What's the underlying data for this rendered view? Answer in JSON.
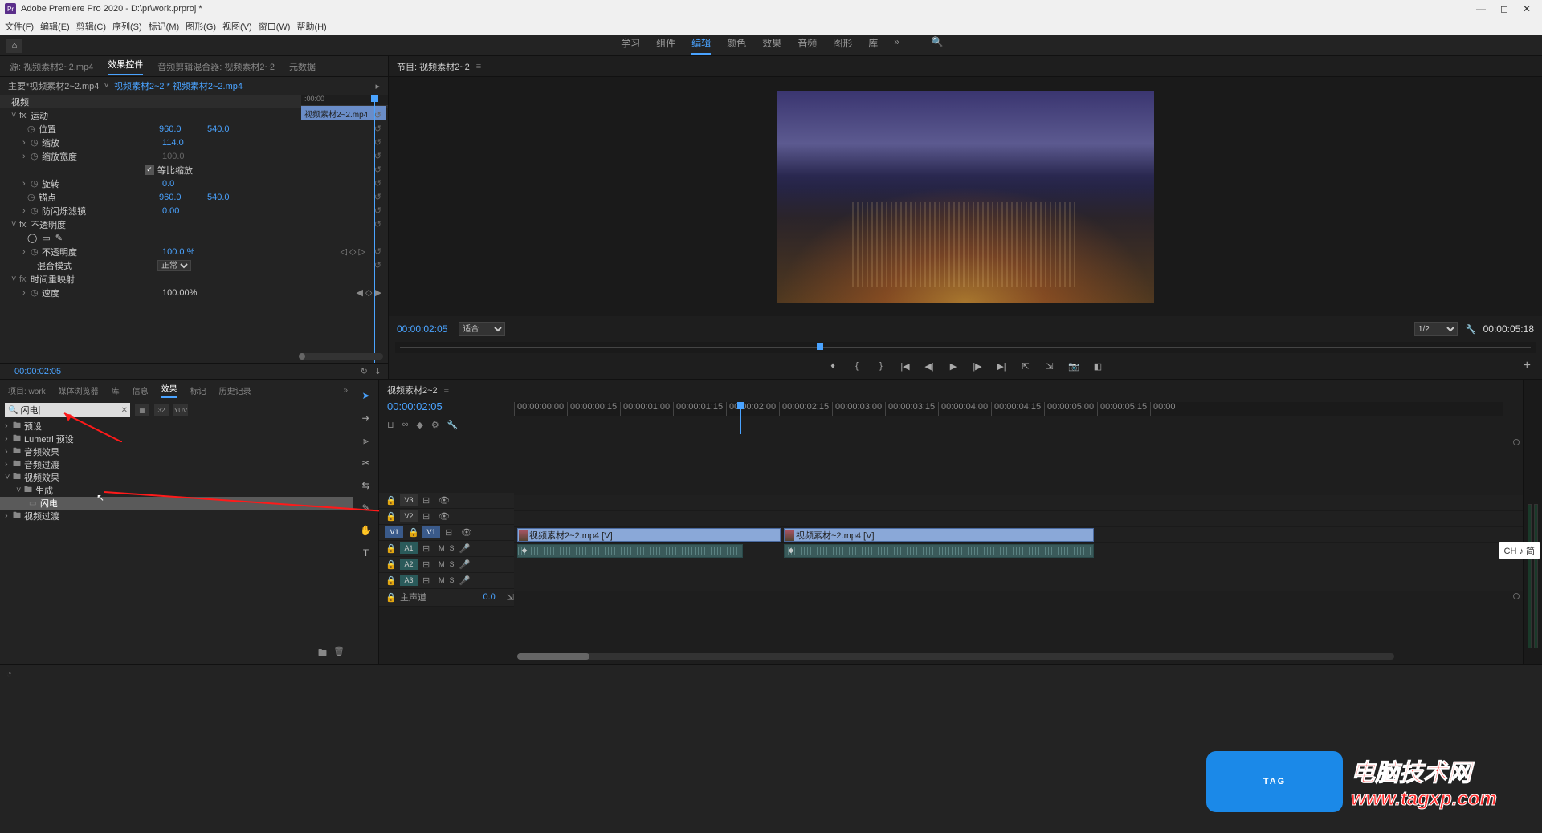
{
  "app": {
    "title": "Adobe Premiere Pro 2020 - D:\\pr\\work.prproj *"
  },
  "menu": {
    "file": "文件(F)",
    "edit": "编辑(E)",
    "clip": "剪辑(C)",
    "seq": "序列(S)",
    "mark": "标记(M)",
    "graph": "图形(G)",
    "view": "视图(V)",
    "window": "窗口(W)",
    "help": "帮助(H)"
  },
  "workspaces": {
    "learn": "学习",
    "assembly": "组件",
    "editing": "编辑",
    "color": "颜色",
    "effects": "效果",
    "audio": "音频",
    "graphics": "图形",
    "library": "库"
  },
  "sourceTabs": {
    "source": "源: 视频素材2~2.mp4",
    "effectControls": "效果控件",
    "audioMixer": "音频剪辑混合器: 视频素材2~2",
    "metadata": "元数据"
  },
  "effectHeader": {
    "path1": "主要*视频素材2~2.mp4",
    "path2": "视频素材2~2 * 视频素材2~2.mp4",
    "miniTime": ":00:00",
    "miniClip": "视频素材2~2.mp4"
  },
  "props": {
    "video": "视频",
    "motion": "运动",
    "position": "位置",
    "posX": "960.0",
    "posY": "540.0",
    "scale": "缩放",
    "scaleV": "114.0",
    "scaleW": "缩放宽度",
    "scaleWV": "100.0",
    "uniform": "等比缩放",
    "rotation": "旋转",
    "rotV": "0.0",
    "anchor": "锚点",
    "anchX": "960.0",
    "anchY": "540.0",
    "flicker": "防闪烁滤镜",
    "flickV": "0.00",
    "opacity": "不透明度",
    "opacityVal": "不透明度",
    "opacityPct": "100.0 %",
    "blend": "混合模式",
    "blendV": "正常",
    "remap": "时间重映射",
    "speed": "速度",
    "speedV": "100.00%"
  },
  "sourceTC": "00:00:02:05",
  "program": {
    "label": "节目: 视频素材2~2",
    "tc": "00:00:02:05",
    "fit": "适合",
    "frac": "1/2",
    "tcRight": "00:00:05:18"
  },
  "effectsTabs": {
    "project": "项目: work",
    "media": "媒体浏览器",
    "lib": "库",
    "info": "信息",
    "effects": "效果",
    "markers": "标记",
    "history": "历史记录"
  },
  "search": {
    "value": "闪电"
  },
  "tree": {
    "presets": "预设",
    "lumetri": "Lumetri 预设",
    "audioFx": "音频效果",
    "audioTr": "音频过渡",
    "videoFx": "视频效果",
    "generate": "生成",
    "lightning": "闪电",
    "videoTr": "视频过渡"
  },
  "tools": {
    "select": "▸",
    "trackSelect": "⇥",
    "ripple": "✂",
    "blade": "✂",
    "slip": "⇄",
    "pen": "✎",
    "hand": "✋",
    "type": "T"
  },
  "timeline": {
    "name": "视频素材2~2",
    "tc": "00:00:02:05",
    "ticks": [
      "00:00:00:00",
      "00:00:00:15",
      "00:00:01:00",
      "00:00:01:15",
      "00:00:02:00",
      "00:00:02:15",
      "00:00:03:00",
      "00:00:03:15",
      "00:00:04:00",
      "00:00:04:15",
      "00:00:05:00",
      "00:00:05:15",
      "00:00"
    ],
    "v3": "V3",
    "v2": "V2",
    "v1": "V1",
    "a1": "A1",
    "a2": "A2",
    "a3": "A3",
    "master": "主声道",
    "masterVal": "0.0",
    "clip1": "视频素材2~2.mp4 [V]",
    "clip2": "视频素材~2.mp4 [V]"
  },
  "badge": {
    "tag": "TAG",
    "l1": "电脑技术网",
    "l2": "www.tagxp.com"
  },
  "ime": "CH ♪ 简"
}
